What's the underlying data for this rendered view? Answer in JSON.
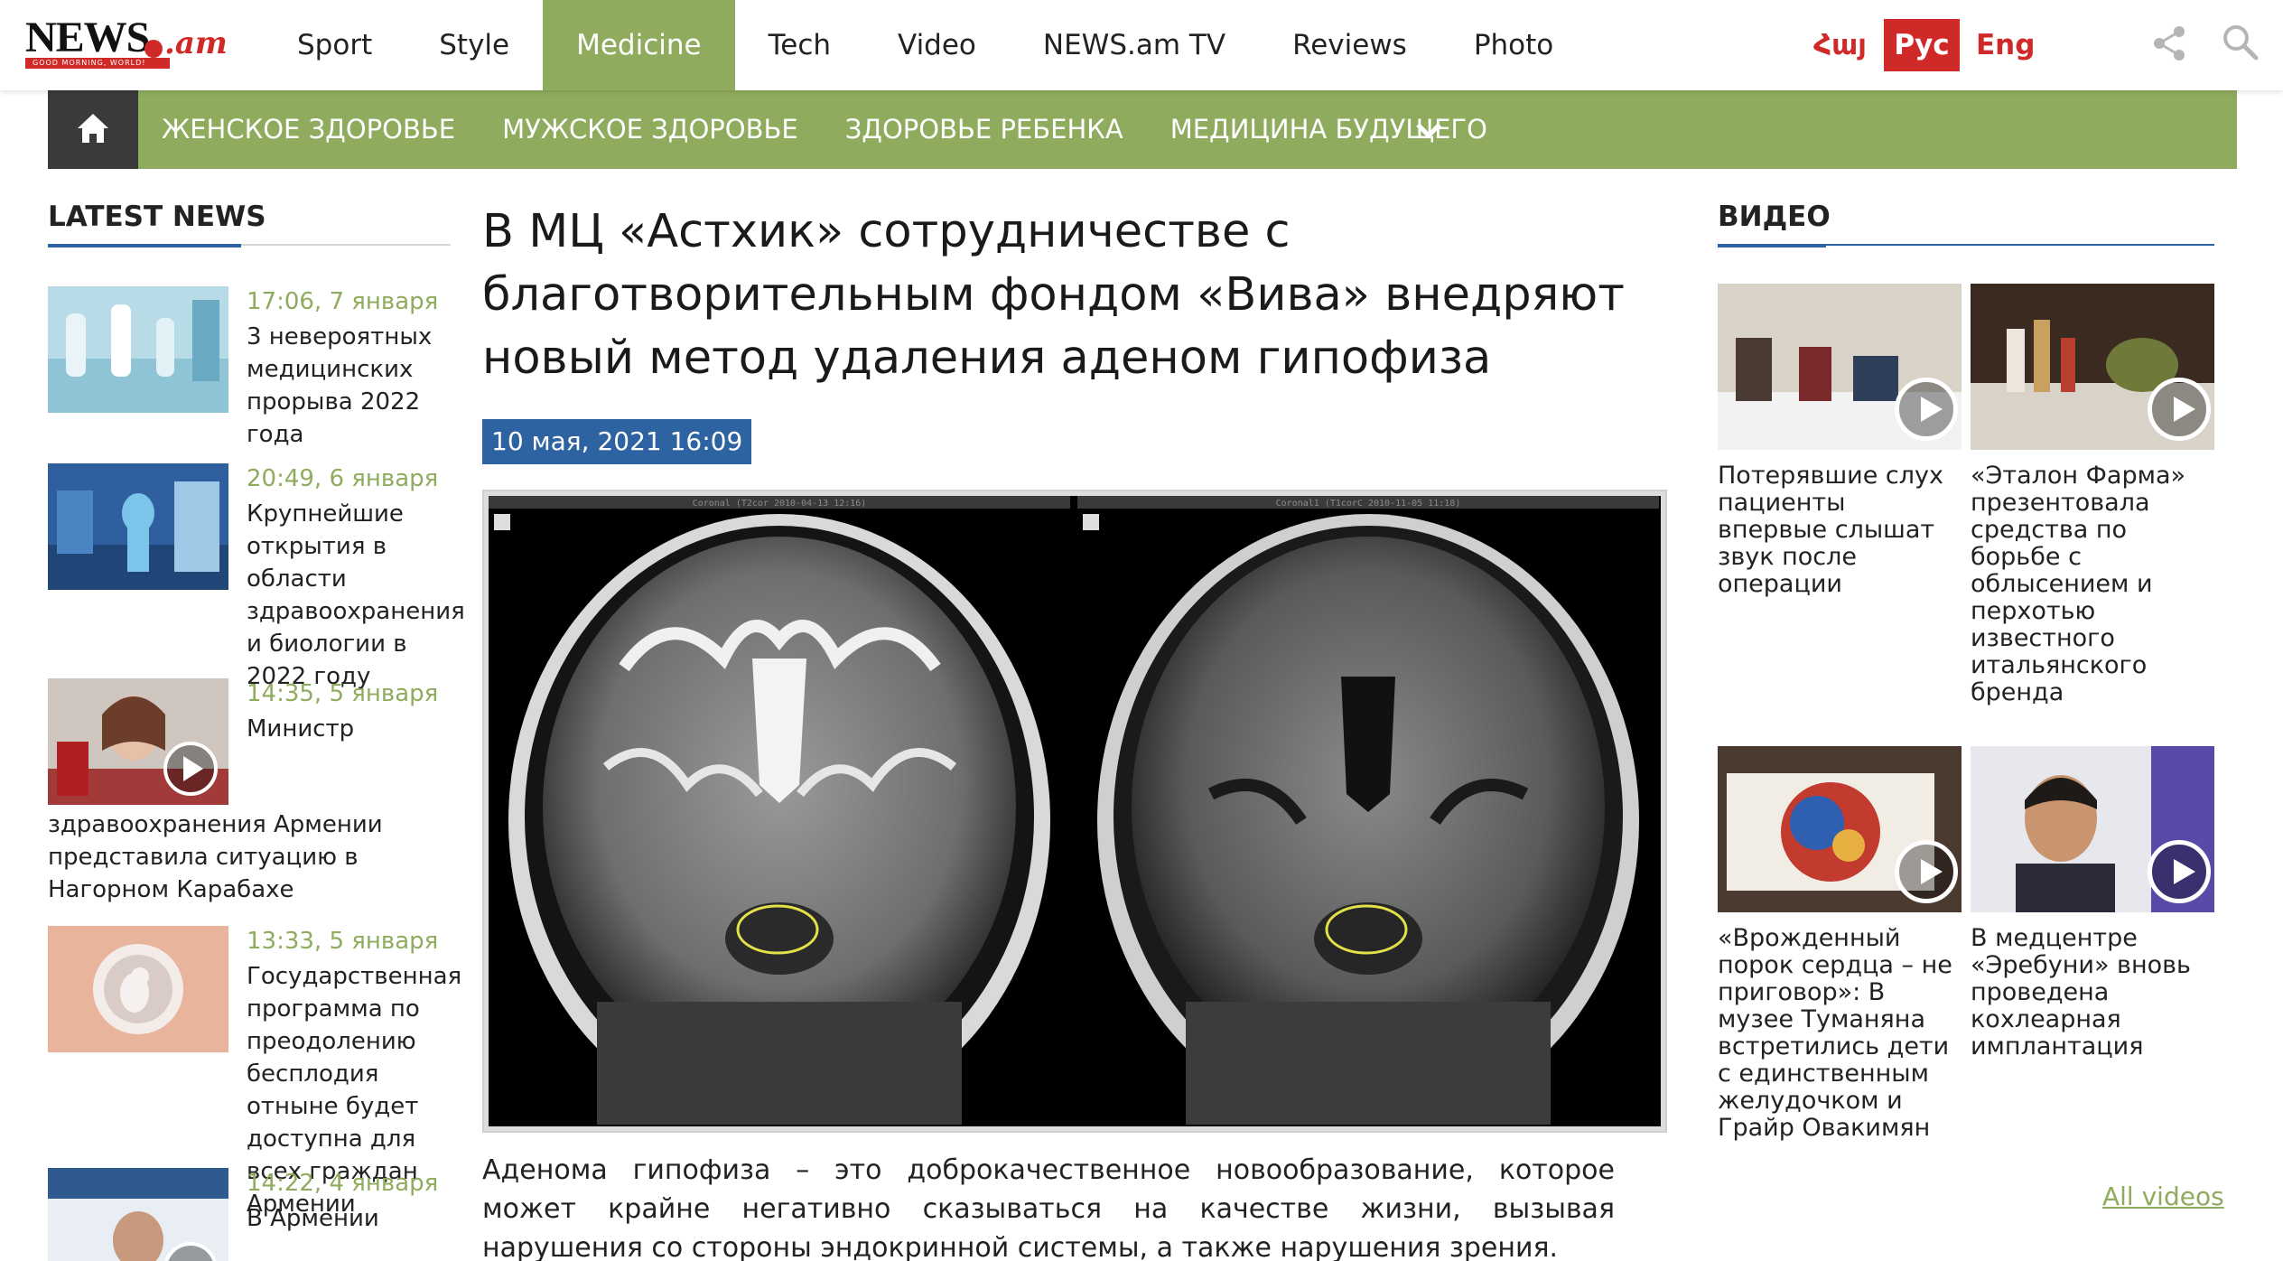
{
  "logo": {
    "brand": "NEWS",
    "suffix": ".am",
    "tagline": "GOOD MORNING, WORLD!"
  },
  "nav": {
    "items": [
      "Sport",
      "Style",
      "Medicine",
      "Tech",
      "Video",
      "NEWS.am TV",
      "Reviews",
      "Photo"
    ],
    "active": "Medicine"
  },
  "languages": {
    "hy": "Հայ",
    "ru": "Рус",
    "en": "Eng",
    "selected": "Рус"
  },
  "icons": {
    "share": "share-icon",
    "search": "search-icon",
    "home": "home-icon",
    "more": "chevron-down-icon",
    "play": "play-icon"
  },
  "colors": {
    "accent_green": "#8fac5e",
    "brand_red": "#cf2a27",
    "date_blue": "#2e63a2",
    "home_dark": "#3a3a3a"
  },
  "subnav": {
    "items": [
      "ЖЕНСКОЕ ЗДОРОВЬЕ",
      "МУЖСКОЕ ЗДОРОВЬЕ",
      "ЗДОРОВЬЕ РЕБЕНКА",
      "МЕДИЦИНА БУДУЩЕГО"
    ]
  },
  "latest": {
    "title": "LATEST NEWS",
    "items": [
      {
        "time": "17:06,  7 января",
        "title_first": "3 невероятных",
        "title_rest": "медицинских прорыва 2022 года"
      },
      {
        "time": "20:49,  6 января",
        "title_first": "Крупнейшие",
        "title_rest": "открытия в области здравоохранения и биологии в 2022 году"
      },
      {
        "time": "14:35,  5 января",
        "title_first": "Министр",
        "title_rest": "здравоохранения Армении представила ситуацию в Нагорном Карабахе"
      },
      {
        "time": "13:33,  5 января",
        "title_first": "Государственная",
        "title_rest": "программа по преодолению бесплодия отныне будет доступна для всех граждан Армении"
      },
      {
        "time": "14:22,  4 января",
        "title_first": "В Армении",
        "title_rest": ""
      }
    ]
  },
  "article": {
    "title": "В МЦ «Астхик» сотрудничестве с благотворительным фондом «Вива» внедряют новый метод удаления аденом гипофиза",
    "date": "10 мая, 2021  16:09",
    "figure": {
      "left_label": "Coronal (T2cor 2010-04-13 12:16)",
      "right_label": "Coronal1 (T1corC 2010-11-05 11:18)"
    },
    "lead": "Аденома гипофиза – это доброкачественное новообразование, которое может крайне негативно сказываться на качестве жизни, вызывая нарушения со стороны эндокринной системы, а также нарушения зрения."
  },
  "videos": {
    "title": "ВИДЕО",
    "items": [
      {
        "title": "Потерявшие слух пациенты впервые слышат звук после операции"
      },
      {
        "title": "«Эталон Фарма» презентовала средства по борьбе с облысением и перхотью известного итальянского бренда"
      },
      {
        "title": "«Врожденный порок сердца – не приговор»: В музее Туманяна встретились дети с единственным желудочком и Грайр Овакимян"
      },
      {
        "title": "В медцентре «Эребуни» вновь проведена кохлеарная имплантация"
      }
    ],
    "all_link": "All videos"
  }
}
